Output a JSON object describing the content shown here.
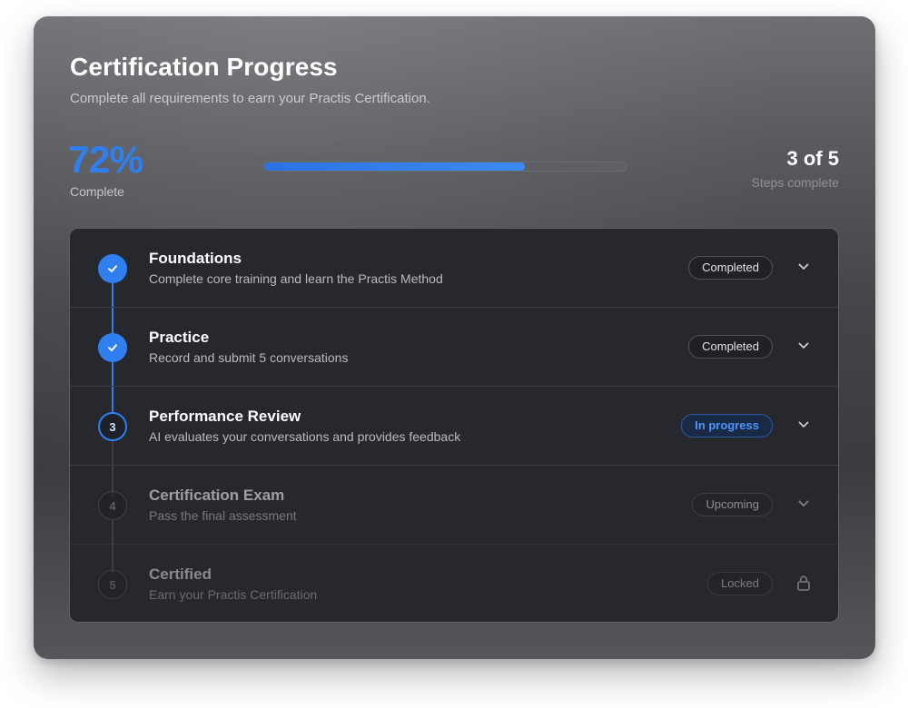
{
  "header": {
    "title": "Certification Progress",
    "subtitle": "Complete all requirements to earn your Practis Certification."
  },
  "progress": {
    "percent_text": "72%",
    "percent_label": "Complete",
    "fraction": 0.72,
    "steps_text": "3 of 5",
    "steps_label": "Steps complete"
  },
  "colors": {
    "accent": "#2f7ff0",
    "card_bg": "#3a3c40"
  },
  "steps": [
    {
      "marker": "check",
      "title": "Foundations",
      "description": "Complete core training and learn the Practis Method",
      "status": "Completed",
      "trailing_icon": "chevron-down-icon"
    },
    {
      "marker": "check",
      "title": "Practice",
      "description": "Record and submit 5 conversations",
      "status": "Completed",
      "trailing_icon": "chevron-down-icon"
    },
    {
      "marker": "3",
      "title": "Performance Review",
      "description": "AI evaluates your conversations and provides feedback",
      "status": "In progress",
      "trailing_icon": "chevron-down-icon"
    },
    {
      "marker": "4",
      "title": "Certification Exam",
      "description": "Pass the final assessment",
      "status": "Upcoming",
      "trailing_icon": "chevron-down-icon"
    },
    {
      "marker": "5",
      "title": "Certified",
      "description": "Earn your Practis Certification",
      "status": "Locked",
      "trailing_icon": "lock-icon"
    }
  ]
}
